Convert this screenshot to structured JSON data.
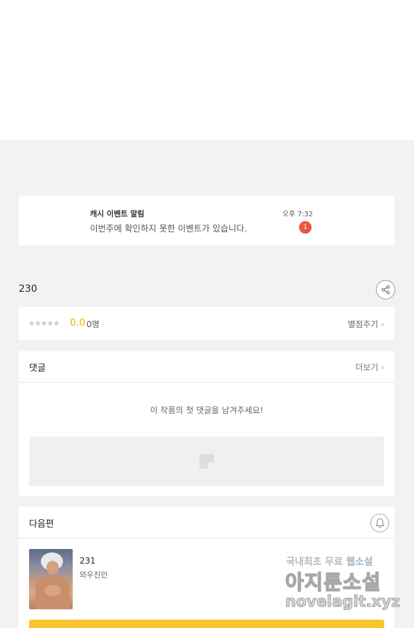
{
  "notice": {
    "title": "캐시 이벤트 알림",
    "message": "이번주에 확인하지 못한 이벤트가 있습니다.",
    "time": "오후 7:32",
    "badge_count": "1"
  },
  "episode": {
    "title": "230",
    "share_icon": "share-icon"
  },
  "rating": {
    "stars": "★★★★★",
    "score": "0.0",
    "count": "0명",
    "rate_link": "별점주기"
  },
  "comments": {
    "title": "댓글",
    "more_label": "더보기",
    "empty_message": "이 작품의 첫 댓글을 남겨주세요!"
  },
  "next_episode": {
    "title": "다음편",
    "number": "231",
    "subtitle": "와우진인",
    "bell_icon": "bell-icon"
  },
  "watermark": {
    "line1_a": "국내최초 무료",
    "line1_b": "웹소설",
    "line2_a": "아지툰",
    "line2_b": "소설",
    "line3": "novelagit.xyz"
  },
  "colors": {
    "accent_yellow": "#f8c42b",
    "score_yellow": "#f0b400",
    "badge_red": "#e8573f"
  }
}
